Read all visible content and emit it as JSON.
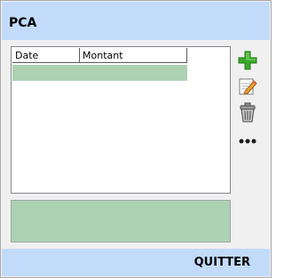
{
  "window": {
    "title": "PCA"
  },
  "grid": {
    "columns": [
      "Date",
      "Montant"
    ],
    "rows": [
      {
        "date": "",
        "montant": "",
        "selected": true
      }
    ]
  },
  "toolbar": {
    "items": [
      {
        "name": "add",
        "icon": "plus-icon"
      },
      {
        "name": "edit",
        "icon": "edit-icon"
      },
      {
        "name": "delete",
        "icon": "trash-icon"
      },
      {
        "name": "more",
        "icon": "more-icon"
      }
    ]
  },
  "footer": {
    "quit_label": "QUITTER"
  },
  "colors": {
    "title_bar": "#c3dbfb",
    "selection": "#add1b3",
    "window_bg": "#f0f0f0",
    "add_icon": "#3aa72a"
  }
}
